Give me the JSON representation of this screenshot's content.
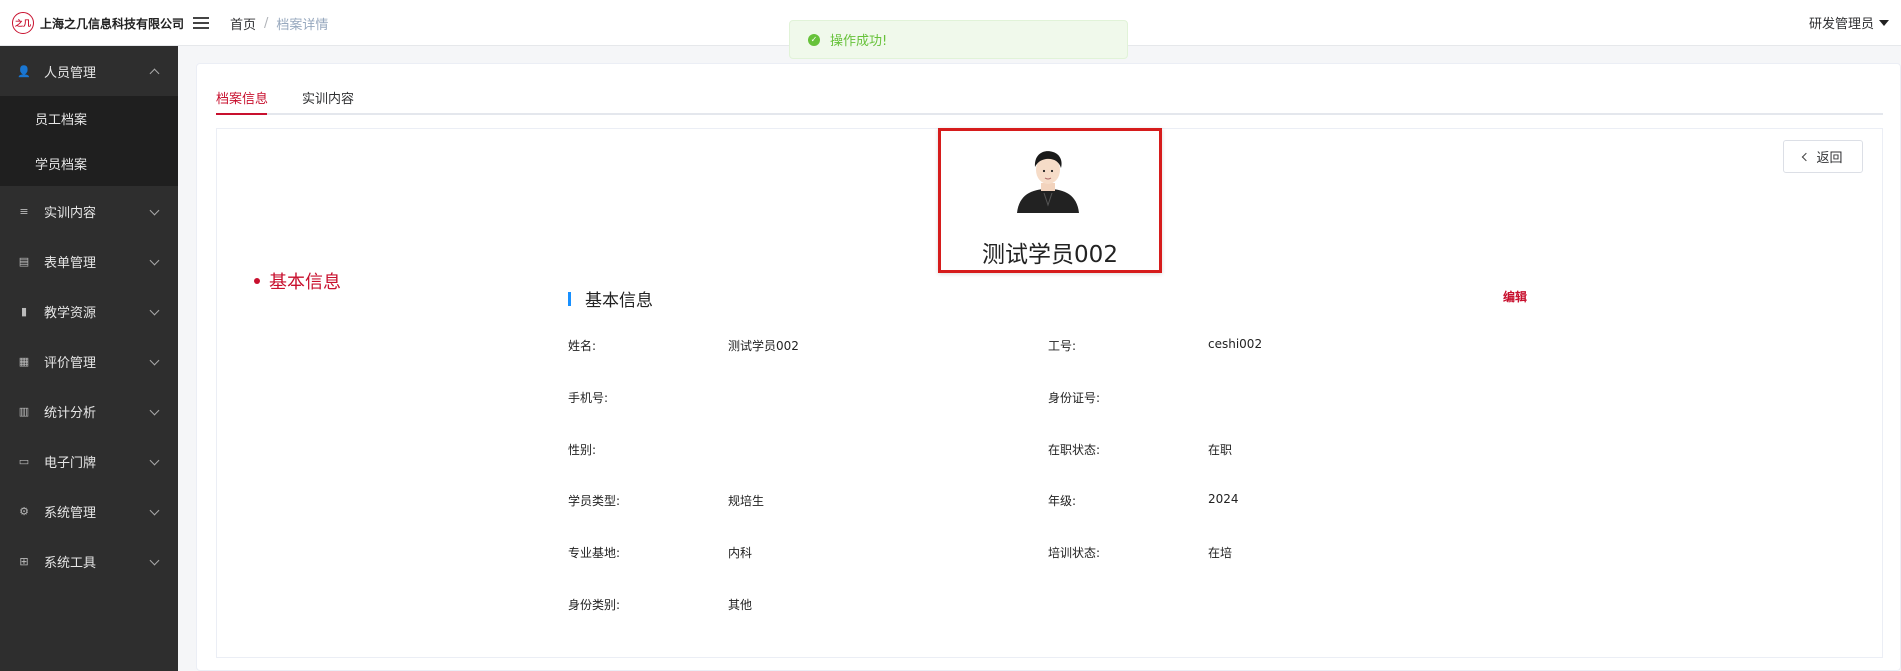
{
  "header": {
    "logo_mark": "之几",
    "company": "上海之几信息科技有限公司",
    "breadcrumb_home": "首页",
    "breadcrumb_sep": "/",
    "breadcrumb_current": "档案详情",
    "user": "研发管理员"
  },
  "toast": {
    "icon": "✓",
    "message": "操作成功!"
  },
  "sidebar": {
    "items": [
      {
        "label": "人员管理",
        "icon": "users-icon",
        "glyph": "👥",
        "expanded": true
      },
      {
        "label": "实训内容",
        "icon": "doc-icon",
        "glyph": "≡"
      },
      {
        "label": "表单管理",
        "icon": "form-icon",
        "glyph": "▤"
      },
      {
        "label": "教学资源",
        "icon": "book-icon",
        "glyph": "▮"
      },
      {
        "label": "评价管理",
        "icon": "rating-icon",
        "glyph": "▦"
      },
      {
        "label": "统计分析",
        "icon": "chart-icon",
        "glyph": "▥"
      },
      {
        "label": "电子门牌",
        "icon": "monitor-icon",
        "glyph": "▭"
      },
      {
        "label": "系统管理",
        "icon": "gear-icon",
        "glyph": "⚙"
      },
      {
        "label": "系统工具",
        "icon": "toolbox-icon",
        "glyph": "⊞"
      }
    ],
    "sub_items": [
      "员工档案",
      "学员档案"
    ]
  },
  "tabs": [
    "档案信息",
    "实训内容"
  ],
  "profile": {
    "name": "测试学员002"
  },
  "back_label": "返回",
  "anchor_label": "基本信息",
  "section": {
    "title": "基本信息",
    "edit": "编辑"
  },
  "fields": {
    "name_label": "姓名:",
    "name_value": "测试学员002",
    "emp_no_label": "工号:",
    "emp_no_value": "ceshi002",
    "phone_label": "手机号:",
    "phone_value": "",
    "id_card_label": "身份证号:",
    "id_card_value": "",
    "gender_label": "性别:",
    "gender_value": "",
    "job_status_label": "在职状态:",
    "job_status_value": "在职",
    "student_type_label": "学员类型:",
    "student_type_value": "规培生",
    "grade_label": "年级:",
    "grade_value": "2024",
    "base_label": "专业基地:",
    "base_value": "内科",
    "train_status_label": "培训状态:",
    "train_status_value": "在培",
    "identity_label": "身份类别:",
    "identity_value": "其他"
  },
  "colors": {
    "accent": "#c8102e",
    "sidebar_bg": "#2e2e2e",
    "toast_green": "#67c23a",
    "section_bar": "#1890ff"
  }
}
